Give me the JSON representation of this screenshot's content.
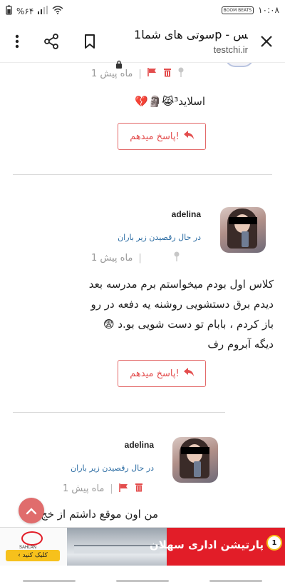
{
  "status_bar": {
    "time": "۱۰:۰۸",
    "battery": "%۶۴",
    "boost_badge": "BOOM BEATS"
  },
  "toolbar": {
    "page_title": "سوتی های شما1p - تس..",
    "url": "testchi.ir",
    "icons": [
      "close-icon",
      "lock-icon",
      "bookmark-icon",
      "share-icon",
      "more-vert-icon"
    ]
  },
  "comments": [
    {
      "time_ago": "1 ماه پیش",
      "text": "اسلاید³😹🗿💔",
      "reply_label": "پاسخ میدهم!"
    },
    {
      "username": "adelina",
      "status": "در حال رقصیدن زیر باران",
      "time_ago": "1 ماه پیش",
      "text_lines": [
        "کلاس اول بودم میخواستم برم مدرسه بعد",
        "دیدم برق دستشویی روشنه یه دفعه در رو",
        "باز کردم ، بابام تو دست شویی بو.د 😨",
        "دیگه آبروم رف"
      ],
      "reply_label": "پاسخ میدهم!"
    },
    {
      "username": "adelina",
      "status": "در حال رقصیدن زیر باران",
      "time_ago": "1 ماه پیش",
      "text": "من اون موقع داشتم از خج"
    }
  ],
  "ad": {
    "logo_text": "SAHLAN",
    "cta_label": "کلیک کنید ›",
    "headline": "پارتیشن اداری سهلان",
    "badge": "1"
  },
  "colors": {
    "accent": "#e34d4d",
    "link": "#2b6ca3",
    "ad_red": "#e21d28",
    "ad_yellow": "#f6c11c"
  }
}
